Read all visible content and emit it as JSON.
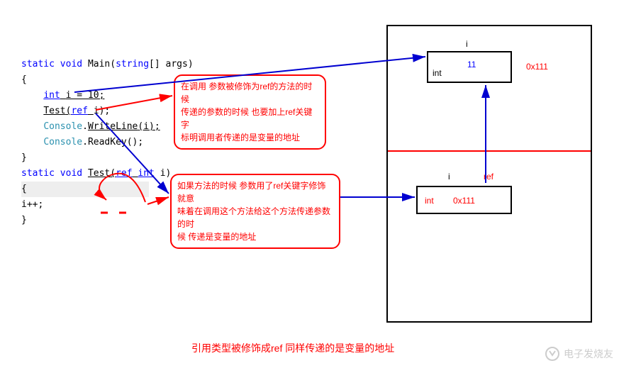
{
  "code": {
    "line1": {
      "kw1": "static",
      "kw2": "void",
      "name": "Main",
      "paren_open": "(",
      "kw3": "string",
      "bracket": "[]",
      "arg": "args",
      "paren_close": ")"
    },
    "line2": "{",
    "line3": {
      "kw": "int",
      "stmt": "i = 10;"
    },
    "line4": {
      "name": "Test",
      "paren_open": "(",
      "kw": "ref",
      "arg": "i",
      "rest": ");"
    },
    "line5": {
      "cls": "Console",
      "dot": ".",
      "method": "WriteLine",
      "arg": "(i);"
    },
    "line6": {
      "cls": "Console",
      "dot": ".",
      "method": "ReadKey",
      "arg": "();"
    },
    "line7": "}",
    "line8": " ",
    "line9": {
      "kw1": "static",
      "kw2": "void",
      "name": "Test",
      "paren_open": "(",
      "kw3": "ref",
      "kw4": "int",
      "arg": "i",
      "paren_close": ")"
    },
    "line10": "{",
    "line11": "    i++;",
    "line12": "}"
  },
  "comment1": {
    "l1": "在调用 参数被修饰为ref的方法的时候",
    "l2": "传递的参数的时候 也要加上ref关键字",
    "l3": "标明调用者传递的是变量的地址"
  },
  "comment2": {
    "l1": "如果方法的时候 参数用了ref关键字修饰 就意",
    "l2": "味着在调用这个方法给这个方法传递参数的时",
    "l3": "候 传递是变量的地址"
  },
  "memory": {
    "top": {
      "var_label": "i",
      "type": "int",
      "value": "11",
      "addr": "0x111"
    },
    "bottom": {
      "var_label": "i",
      "ref_label": "ref",
      "type": "int",
      "value": "0x111"
    }
  },
  "caption": "引用类型被修饰成ref  同样传递的是变量的地址",
  "watermark": "电子发烧友",
  "colors": {
    "red": "#ff0000",
    "blue": "#0000ff",
    "arrow_blue": "#0000d0"
  }
}
